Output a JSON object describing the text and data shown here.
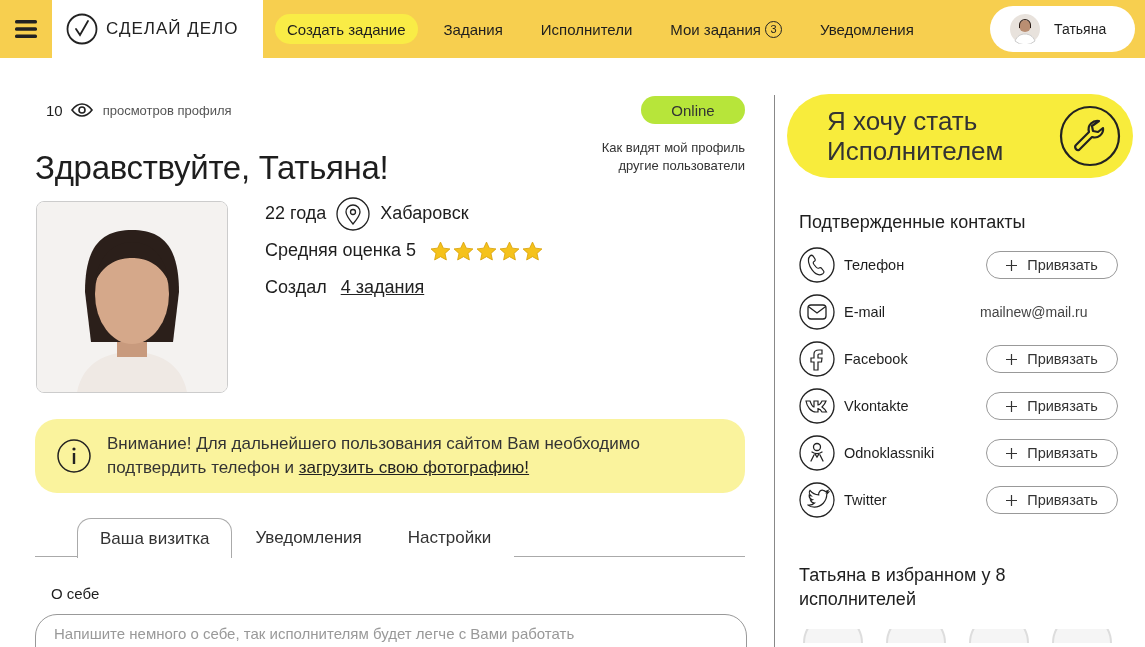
{
  "header": {
    "logo": "СДЕЛАЙ ДЕЛО",
    "nav": [
      {
        "label": "Создать задание",
        "kind": "primary"
      },
      {
        "label": "Задания",
        "kind": "link"
      },
      {
        "label": "Исполнители",
        "kind": "link"
      },
      {
        "label": "Мои задания",
        "kind": "link",
        "badge": "3"
      },
      {
        "label": "Уведомления",
        "kind": "link"
      }
    ],
    "user": {
      "name": "Татьяна"
    }
  },
  "profile": {
    "views_count": "10",
    "views_label": "просмотров профиля",
    "status": "Online",
    "greeting": "Здравствуйте, Татьяна!",
    "preview_link": "Как видят мой профиль другие пользователи",
    "age": "22 года",
    "city": "Хабаровск",
    "rating_label": "Средняя оценка 5",
    "stars": 5,
    "created_label": "Создал",
    "created_link": "4 задания"
  },
  "notice": {
    "text": "Внимание! Для дальнейшего пользования сайтом Вам необходимо подтвердить телефон и",
    "link": "загрузить свою фотографию!"
  },
  "tabs": [
    {
      "label": "Ваша визитка",
      "selected": true
    },
    {
      "label": "Уведомления",
      "selected": false
    },
    {
      "label": "Настройки",
      "selected": false
    }
  ],
  "about": {
    "label": "О себе",
    "placeholder": "Напишите немного о себе, так исполнителям будет легче с Вами работать"
  },
  "sidebar": {
    "cta": "Я хочу стать Исполнителем",
    "contacts_title": "Подтвержденные контакты",
    "contacts": [
      {
        "name": "Телефон",
        "kind": "bind",
        "action": "Привязать"
      },
      {
        "name": "E-mail",
        "kind": "value",
        "value": "mailnew@mail.ru"
      },
      {
        "name": "Facebook",
        "kind": "bind",
        "action": "Привязать"
      },
      {
        "name": "Vkontakte",
        "kind": "bind",
        "action": "Привязать"
      },
      {
        "name": "Odnoklassniki",
        "kind": "bind",
        "action": "Привязать"
      },
      {
        "name": "Twitter",
        "kind": "bind",
        "action": "Привязать"
      }
    ],
    "favorites_title": "Татьяна в избранном у 8 исполнителей"
  }
}
